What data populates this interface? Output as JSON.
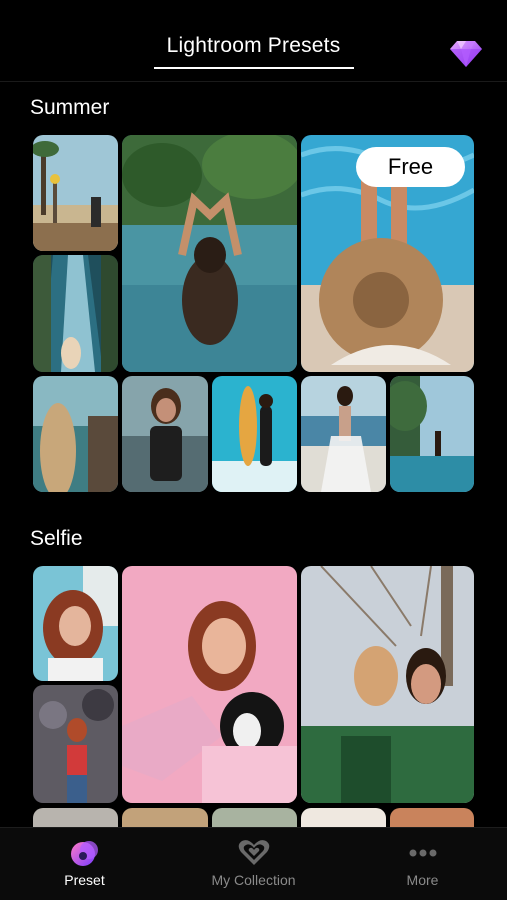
{
  "header": {
    "title": "Lightroom Presets",
    "premium_icon": "diamond-icon"
  },
  "sections": [
    {
      "title": "Summer",
      "badge": "Free"
    },
    {
      "title": "Selfie"
    }
  ],
  "tabbar": {
    "items": [
      {
        "label": "Preset",
        "icon": "preset-icon",
        "active": true
      },
      {
        "label": "My Collection",
        "icon": "heart-collection-icon",
        "active": false
      },
      {
        "label": "More",
        "icon": "more-dots-icon",
        "active": false
      }
    ]
  },
  "colors": {
    "background": "#000000",
    "accent": "#b15cff",
    "tab_inactive": "#8a8a8a"
  }
}
